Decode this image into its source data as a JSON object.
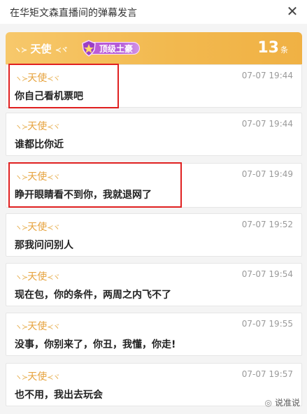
{
  "window": {
    "title": "在华矩文森直播间的弹幕发言",
    "close_icon": "close-icon"
  },
  "banner": {
    "username": "天使",
    "badge": "顶级土豪",
    "count": "13",
    "count_unit": "条"
  },
  "messages": [
    {
      "user": "天使",
      "time": "07-07 19:44",
      "text": "你自己看机票吧"
    },
    {
      "user": "天使",
      "time": "07-07 19:44",
      "text": "谁都比你近"
    },
    {
      "user": "天使",
      "time": "07-07 19:49",
      "text": "睁开眼睛看不到你，我就退网了"
    },
    {
      "user": "天使",
      "time": "07-07 19:52",
      "text": "那我问问别人"
    },
    {
      "user": "天使",
      "time": "07-07 19:54",
      "text": "现在包，你的条件，两周之内飞不了"
    },
    {
      "user": "天使",
      "time": "07-07 19:55",
      "text": "没事，你别来了，你丑，我懂，你走!"
    },
    {
      "user": "天使",
      "time": "07-07 19:57",
      "text": "也不用，我出去玩会"
    }
  ],
  "watermark": {
    "text": "说准说"
  },
  "colors": {
    "banner": "#f2b94f",
    "username": "#e6a23c",
    "highlight": "#e02020",
    "badge": "#b35ad8"
  }
}
